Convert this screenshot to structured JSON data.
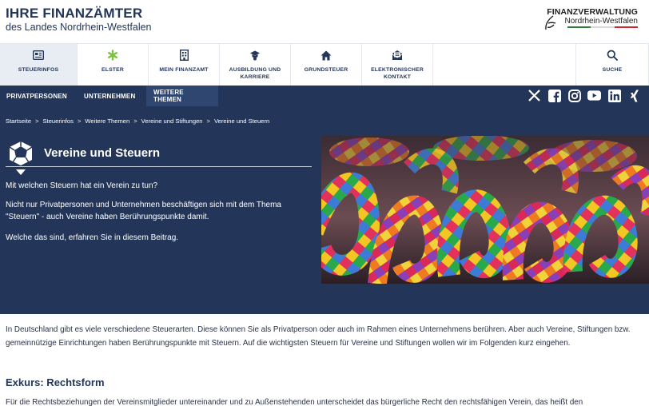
{
  "header": {
    "title": "IHRE FINANZÄMTER",
    "subtitle": "des Landes Nordrhein-Westfalen",
    "logo_line1": "FINANZVERWALTUNG",
    "logo_line2": "Nordrhein-Westfalen",
    "logo_flag_colors": [
      "#2f7d3a",
      "#ffffff",
      "#d9232e"
    ]
  },
  "main_nav": [
    {
      "label": "STEUERINFOS",
      "icon": "newspaper-icon",
      "active": true
    },
    {
      "label": "ELSTER",
      "icon": "elster-star-icon",
      "active": false
    },
    {
      "label": "MEIN FINANZAMT",
      "icon": "building-icon",
      "active": false
    },
    {
      "label": "AUSBILDUNG UND KARRIERE",
      "icon": "graduation-icon",
      "active": false
    },
    {
      "label": "GRUNDSTEUER",
      "icon": "house-icon",
      "active": false
    },
    {
      "label": "ELEKTRONISCHER KONTAKT",
      "icon": "mail-icon",
      "active": false
    }
  ],
  "search": {
    "label": "SUCHE",
    "icon": "search-icon"
  },
  "sub_nav": [
    {
      "label": "PRIVATPERSONEN",
      "active": false
    },
    {
      "label": "UNTERNEHMEN",
      "active": false
    },
    {
      "label": "WEITERE THEMEN",
      "active": true
    }
  ],
  "social": [
    "x-icon",
    "facebook-icon",
    "instagram-icon",
    "youtube-icon",
    "linkedin-icon",
    "xing-icon"
  ],
  "breadcrumb": [
    "Startseite",
    "Steuerinfos",
    "Weitere Themen",
    "Vereine und Stiftungen",
    "Vereine und Steuern"
  ],
  "breadcrumb_sep": ">",
  "hero": {
    "title": "Vereine und Steuern",
    "p1": "Mit welchen Steuern hat ein Verein zu tun?",
    "p2": "Nicht nur Privatpersonen und Unternehmen beschäftigen sich mit dem Thema \"Steuern\" - auch Vereine haben Berührungspunkte damit.",
    "p3": "Welche das sind, erfahren Sie in diesem Beitrag."
  },
  "intro": "In Deutschland gibt es viele verschiedene Steuerarten. Diese können Sie als Privatperson oder auch im Rahmen eines Unternehmens berühren. Aber auch Vereine, Stiftungen bzw. gemeinnützige Einrichtungen haben Berührungspunkte mit Steuern. Auf die wichtigsten Steuern für Vereine und Stiftungen wollen wir im Folgenden kurz eingehen.",
  "section": {
    "heading": "Exkurs: Rechtsform",
    "text": "Für die Rechtsbeziehungen der Vereinsmitglieder untereinander und zu Außenstehenden unterscheidet das bürgerliche Recht den rechtsfähigen Verein, das heißt den"
  },
  "colors": {
    "navy": "#233659",
    "active_subnav": "#2f4670",
    "nav_active_bg": "#e8ecf3",
    "elster_green": "#7cc242"
  }
}
